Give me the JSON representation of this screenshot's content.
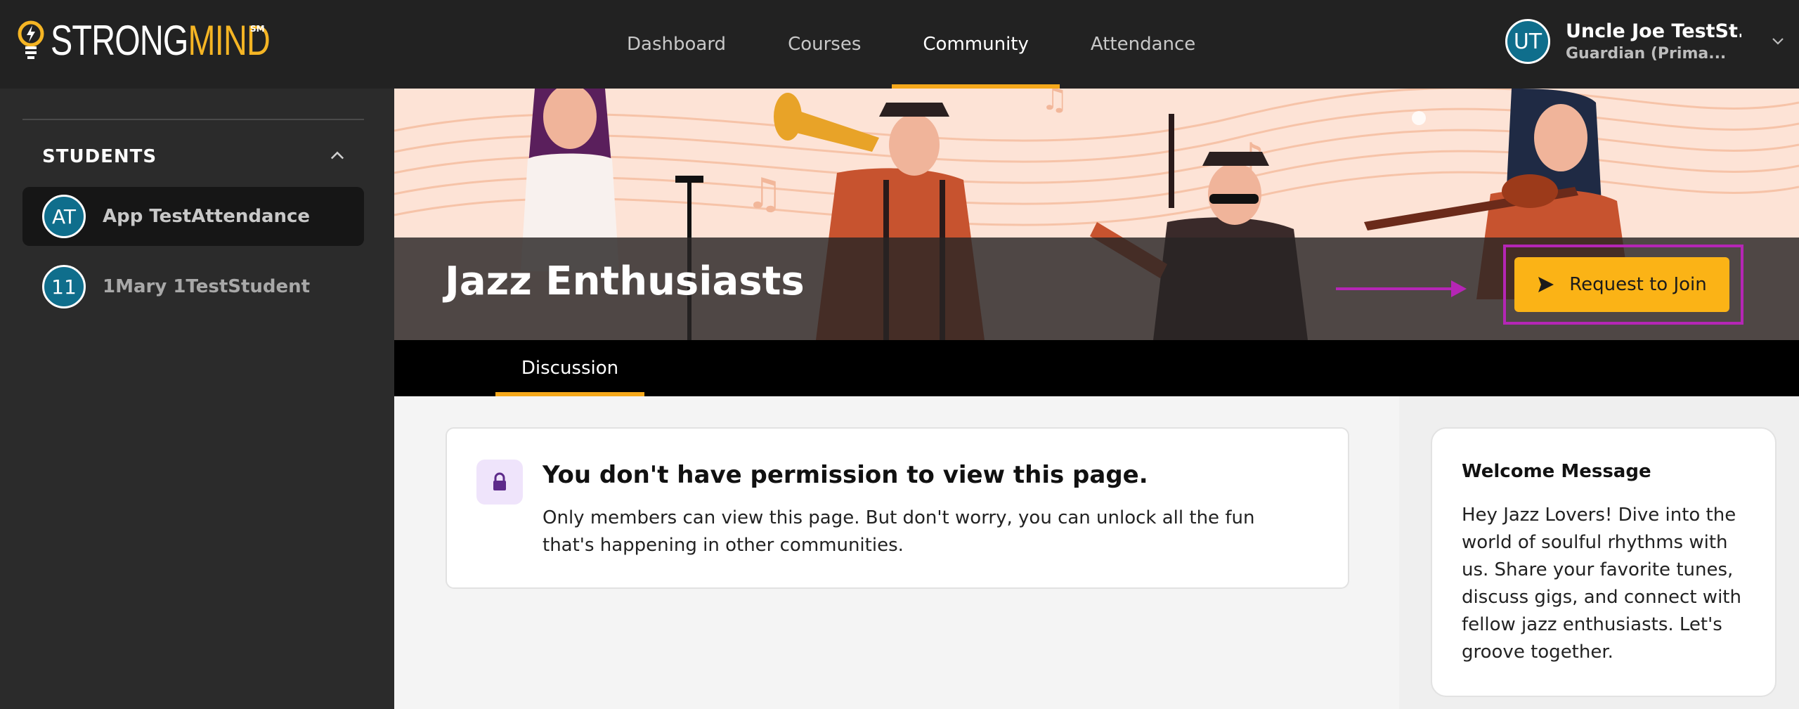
{
  "app": {
    "logo_part1": "STRONG",
    "logo_part2": "MIND",
    "logo_mark": "SM"
  },
  "nav": {
    "items": [
      {
        "label": "Dashboard",
        "active": false
      },
      {
        "label": "Courses",
        "active": false
      },
      {
        "label": "Community",
        "active": true
      },
      {
        "label": "Attendance",
        "active": false
      }
    ]
  },
  "user": {
    "initials": "UT",
    "name": "Uncle Joe TestSt...",
    "role": "Guardian (Prima...",
    "menu_icon": "chevron-down-icon"
  },
  "sidebar": {
    "section_title": "STUDENTS",
    "collapse_icon": "chevron-up-icon",
    "students": [
      {
        "initials": "AT",
        "name": "App TestAttendance",
        "selected": true
      },
      {
        "initials": "11",
        "name": "1Mary 1TestStudent",
        "selected": false
      }
    ]
  },
  "banner": {
    "title": "Jazz Enthusiasts",
    "join_label": "Request to Join",
    "join_icon": "send-icon",
    "annotation_color": "#b526b5"
  },
  "tabs": [
    {
      "label": "Discussion",
      "active": true
    }
  ],
  "permission": {
    "icon": "lock-icon",
    "title": "You don't have permission to view this page.",
    "body": "Only members can view this page. But don't worry, you can unlock all the fun that's happening in other communities."
  },
  "welcome": {
    "title": "Welcome Message",
    "body": "Hey Jazz Lovers! Dive into the world of soulful rhythms with us. Share your favorite tunes, discuss gigs, and connect with fellow jazz enthusiasts. Let's groove together."
  },
  "colors": {
    "accent": "#f5a81b",
    "button": "#fbb316",
    "avatar": "#0f6e8c",
    "topbar": "#222222",
    "sidebar": "#2b2b2b"
  }
}
